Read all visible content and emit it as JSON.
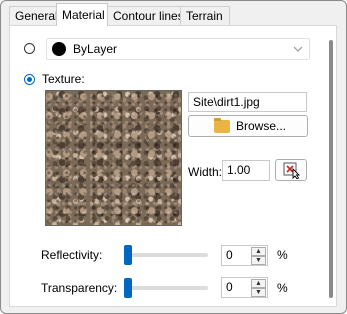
{
  "tabs": [
    "General",
    "Material",
    "Contour lines",
    "Terrain"
  ],
  "active_tab": "Material",
  "bylayer": {
    "label": "ByLayer",
    "selected": false,
    "color": "#000000"
  },
  "texture": {
    "label": "Texture:",
    "selected": true,
    "file": "Site\\dirt1.jpg",
    "browse_label": "Browse...",
    "width_label": "Width:",
    "width_value": "1.00"
  },
  "reflectivity": {
    "label": "Reflectivity:",
    "value": "0",
    "unit": "%",
    "level": 0
  },
  "transparency": {
    "label": "Transparency:",
    "value": "0",
    "unit": "%",
    "level": 0
  },
  "colors": {
    "accent": "#0067c0"
  }
}
